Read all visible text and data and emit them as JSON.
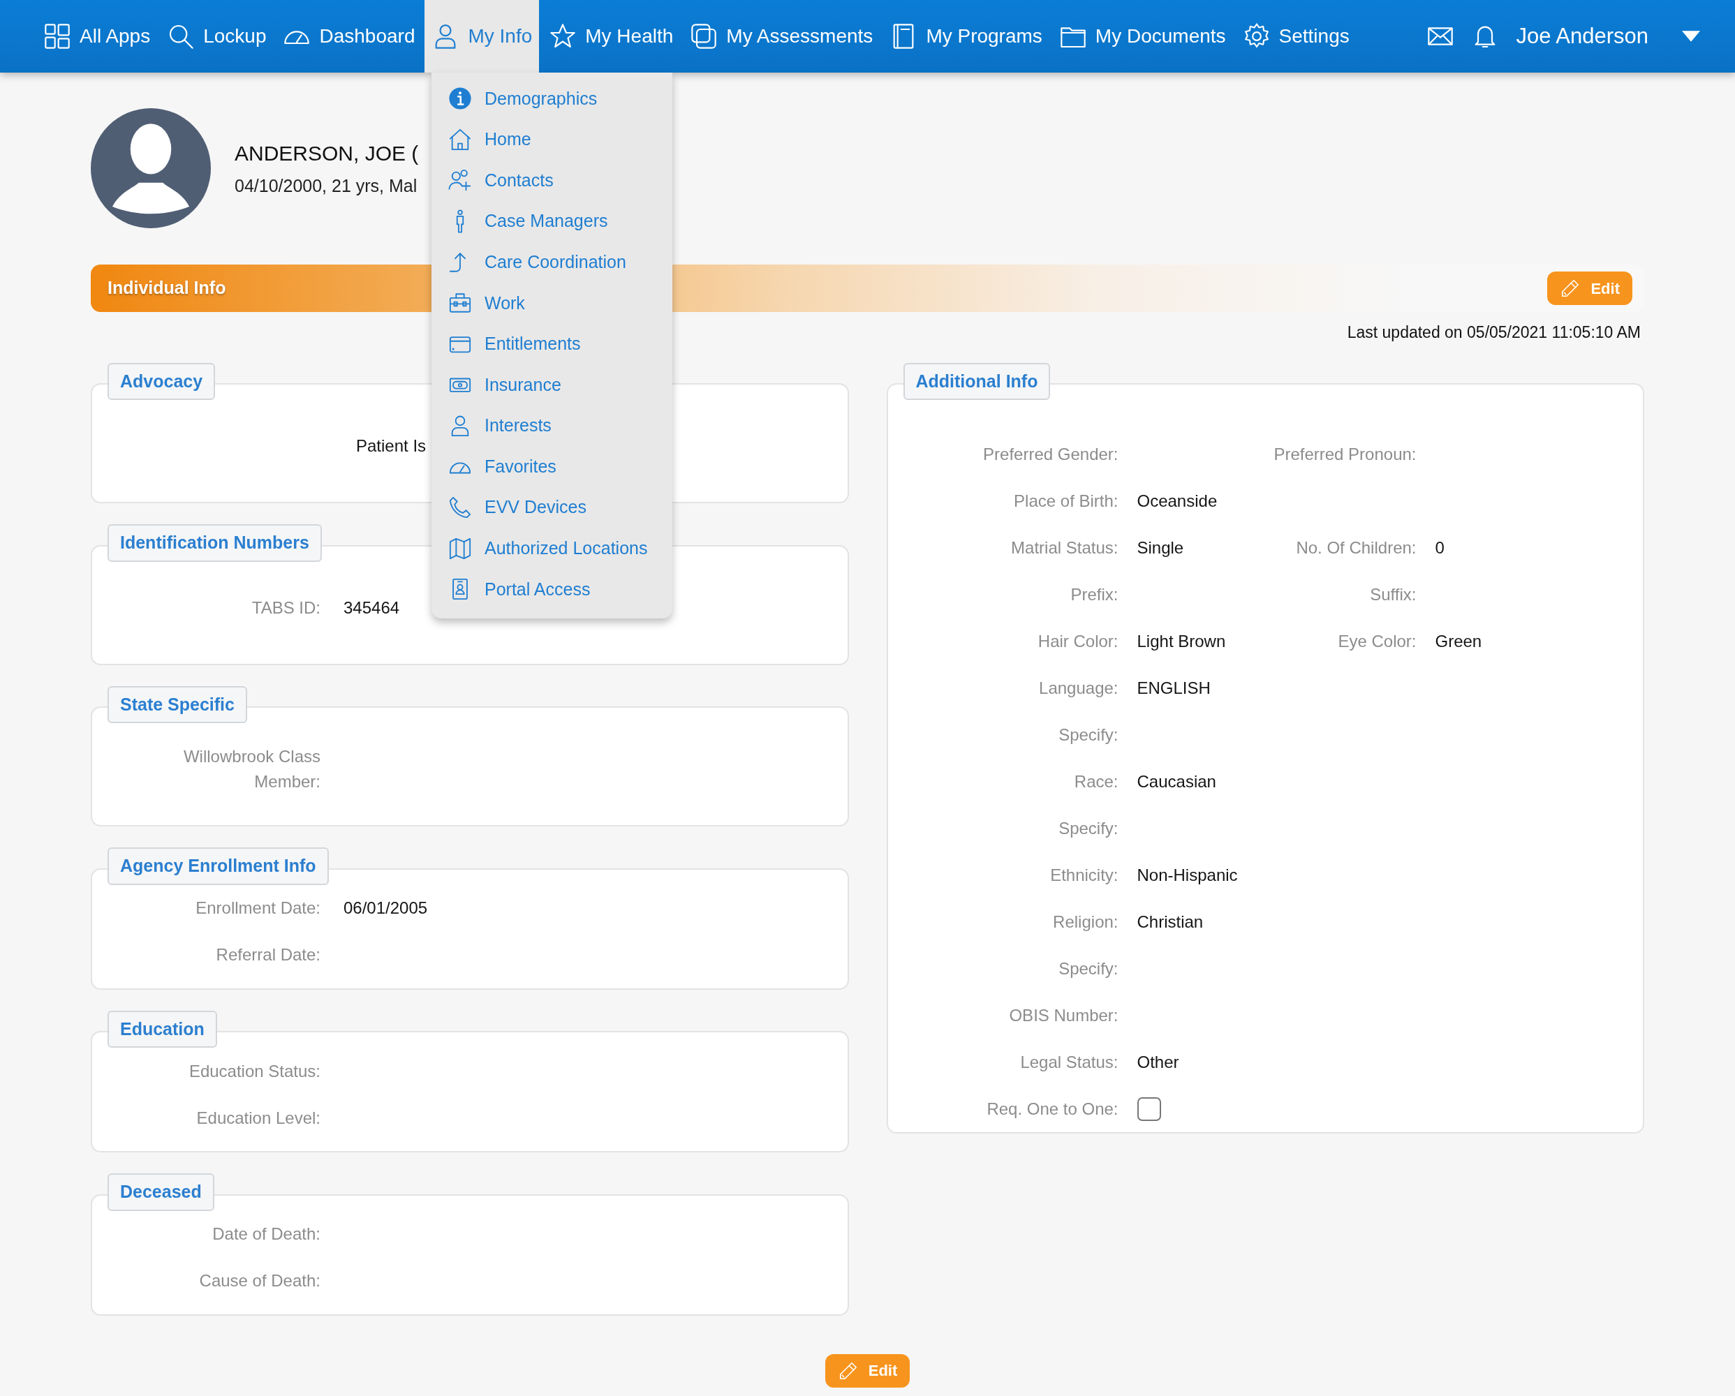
{
  "nav": {
    "items": [
      {
        "label": "All Apps",
        "selected": false
      },
      {
        "label": "Lockup",
        "selected": false
      },
      {
        "label": "Dashboard",
        "selected": false
      },
      {
        "label": "My Info",
        "selected": true
      },
      {
        "label": "My Health",
        "selected": false
      },
      {
        "label": "My Assessments",
        "selected": false
      },
      {
        "label": "My Programs",
        "selected": false
      },
      {
        "label": "My Documents",
        "selected": false
      },
      {
        "label": "Settings",
        "selected": false
      }
    ],
    "user_name": "Joe Anderson"
  },
  "menu": {
    "items": [
      {
        "label": "Demographics"
      },
      {
        "label": "Home"
      },
      {
        "label": "Contacts"
      },
      {
        "label": "Case Managers"
      },
      {
        "label": "Care Coordination"
      },
      {
        "label": "Work"
      },
      {
        "label": "Entitlements"
      },
      {
        "label": "Insurance"
      },
      {
        "label": "Interests"
      },
      {
        "label": "Favorites"
      },
      {
        "label": "EVV Devices"
      },
      {
        "label": "Authorized Locations"
      },
      {
        "label": "Portal Access"
      }
    ]
  },
  "profile": {
    "name": "ANDERSON, JOE (",
    "details": "04/10/2000, 21 yrs, Mal"
  },
  "section": {
    "title": "Individual Info",
    "edit_label": "Edit",
    "last_updated": "Last updated on 05/05/2021 11:05:10 AM"
  },
  "left_panels": [
    {
      "title": "Advocacy",
      "text": "Patient Is"
    },
    {
      "title": "Identification Numbers",
      "fields": [
        {
          "label": "TABS ID:",
          "value": "345464"
        }
      ]
    },
    {
      "title": "State Specific",
      "fields": [
        {
          "label": "Willowbrook Class Member:"
        }
      ]
    },
    {
      "title": "Agency Enrollment Info",
      "fields": [
        {
          "label": "Enrollment Date:",
          "value": "06/01/2005"
        },
        {
          "label": "Referral Date:"
        }
      ]
    },
    {
      "title": "Education",
      "fields": [
        {
          "label": "Education Status:"
        },
        {
          "label": "Education Level:"
        }
      ]
    },
    {
      "title": "Deceased",
      "fields": [
        {
          "label": "Date of Death:"
        },
        {
          "label": "Cause of Death:"
        }
      ]
    }
  ],
  "additional_info": {
    "title": "Additional Info",
    "rows": [
      [
        {
          "kind": "text",
          "label": "Preferred Gender:"
        },
        {
          "kind": "text",
          "label": "Preferred Pronoun:"
        }
      ],
      [
        {
          "kind": "text",
          "label": "Place of Birth:",
          "value": "Oceanside"
        }
      ],
      [
        {
          "kind": "text",
          "label": "Matrial Status:",
          "value": "Single"
        },
        {
          "kind": "text",
          "label": "No. Of Children:",
          "value": "0"
        }
      ],
      [
        {
          "kind": "text",
          "label": "Prefix:"
        },
        {
          "kind": "text",
          "label": "Suffix:"
        }
      ],
      [
        {
          "kind": "text",
          "label": "Hair Color:",
          "value": "Light Brown"
        },
        {
          "kind": "text",
          "label": "Eye Color:",
          "value": "Green"
        }
      ],
      [
        {
          "kind": "text",
          "label": "Language:",
          "value": "ENGLISH"
        }
      ],
      [
        {
          "kind": "text",
          "label": "Specify:"
        }
      ],
      [
        {
          "kind": "text",
          "label": "Race:",
          "value": "Caucasian"
        }
      ],
      [
        {
          "kind": "text",
          "label": "Specify:"
        }
      ],
      [
        {
          "kind": "text",
          "label": "Ethnicity:",
          "value": "Non-Hispanic"
        }
      ],
      [
        {
          "kind": "text",
          "label": "Religion:",
          "value": "Christian"
        }
      ],
      [
        {
          "kind": "text",
          "label": "Specify:"
        }
      ],
      [
        {
          "kind": "text",
          "label": "OBIS Number:"
        }
      ],
      [
        {
          "kind": "text",
          "label": "Legal Status:",
          "value": "Other"
        }
      ],
      [
        {
          "kind": "checkbox",
          "label": "Req. One to One:",
          "checked": false
        }
      ]
    ]
  },
  "footer": {
    "edit_label": "Edit"
  }
}
